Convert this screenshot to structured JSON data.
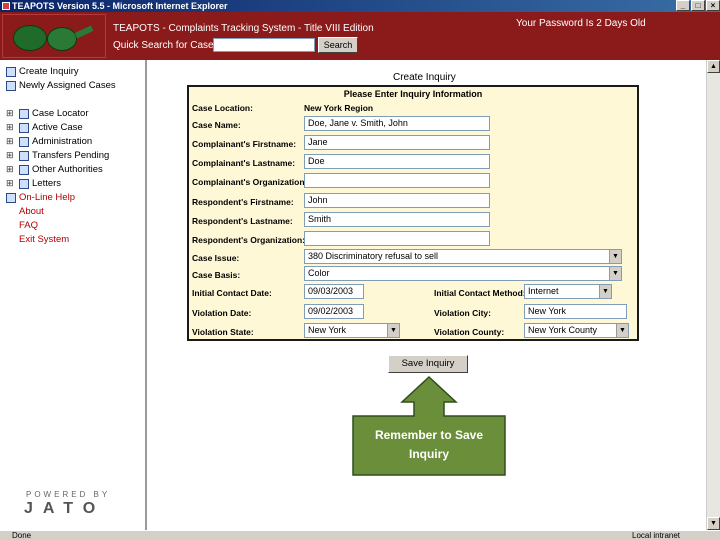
{
  "window": {
    "title": "TEAPOTS Version 5.5 - Microsoft Internet Explorer",
    "buttons": [
      "_",
      "□",
      "×"
    ]
  },
  "header": {
    "system_name": "TEAPOTS - Complaints Tracking System - Title VIII Edition",
    "quick_search_label": "Quick Search for Case",
    "quick_search_value": "",
    "search_button": "Search",
    "password_age": "Your Password Is 2 Days Old"
  },
  "sidebar": {
    "top_items": [
      {
        "label": "Create Inquiry"
      },
      {
        "label": "Newly Assigned Cases"
      }
    ],
    "tree_items": [
      {
        "label": "Case Locator"
      },
      {
        "label": "Active Case"
      },
      {
        "label": "Administration"
      },
      {
        "label": "Transfers Pending"
      },
      {
        "label": "Other Authorities"
      },
      {
        "label": "Letters"
      }
    ],
    "links": [
      {
        "label": "On-Line Help"
      },
      {
        "label": "About"
      },
      {
        "label": "FAQ"
      },
      {
        "label": "Exit System"
      }
    ],
    "powered_by": "POWERED BY",
    "brand": "JATO"
  },
  "form": {
    "title": "Create Inquiry",
    "subtitle": "Please Enter Inquiry Information",
    "case_location_label": "Case Location:",
    "case_location_value": "New York Region",
    "case_name_label": "Case Name:",
    "case_name_value": "Doe, Jane v. Smith, John",
    "complainant_first_label": "Complainant's Firstname:",
    "complainant_first_value": "Jane",
    "complainant_last_label": "Complainant's Lastname:",
    "complainant_last_value": "Doe",
    "complainant_org_label": "Complainant's Organization:",
    "complainant_org_value": "",
    "respondent_first_label": "Respondent's Firstname:",
    "respondent_first_value": "John",
    "respondent_last_label": "Respondent's Lastname:",
    "respondent_last_value": "Smith",
    "respondent_org_label": "Respondent's Organization:",
    "respondent_org_value": "",
    "case_issue_label": "Case Issue:",
    "case_issue_value": "380 Discriminatory refusal to sell",
    "case_basis_label": "Case Basis:",
    "case_basis_value": "Color",
    "initial_contact_date_label": "Initial Contact Date:",
    "initial_contact_date_value": "09/03/2003",
    "initial_contact_method_label": "Initial Contact Method:",
    "initial_contact_method_value": "Internet",
    "violation_date_label": "Violation Date:",
    "violation_date_value": "09/02/2003",
    "violation_city_label": "Violation City:",
    "violation_city_value": "New York",
    "violation_state_label": "Violation State:",
    "violation_state_value": "New York",
    "violation_county_label": "Violation County:",
    "violation_county_value": "New York County",
    "save_button": "Save Inquiry"
  },
  "callout": {
    "line1": "Remember to Save",
    "line2": "Inquiry",
    "fill_color": "#6b8e3a",
    "border_color": "#2f4f1f"
  },
  "statusbar": {
    "left": "Done",
    "right": "Local intranet"
  }
}
